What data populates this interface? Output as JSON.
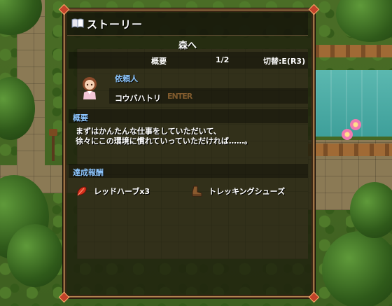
{
  "window": {
    "title": "ストーリー",
    "quest_name": "森へ"
  },
  "summary_row": {
    "label": "概要",
    "page": "1/2",
    "switch": "切替:E(R3)"
  },
  "client": {
    "label": "依頼人",
    "name": "コウバハトリ",
    "watermark": "ENTER"
  },
  "overview": {
    "heading": "概要",
    "lines": [
      "まずはかんたんな仕事をしていただいて、",
      "徐々にこの環境に慣れていっていただければ……。"
    ]
  },
  "rewards": {
    "heading": "達成報酬",
    "items": [
      {
        "icon": "herb-icon",
        "label": "レッドハーブx3"
      },
      {
        "icon": "boot-icon",
        "label": "トレッキングシューズ"
      }
    ]
  },
  "colors": {
    "accent_blue": "#8ec7ff",
    "window_bg": "#1e200e",
    "frame": "#6b4a2a"
  }
}
